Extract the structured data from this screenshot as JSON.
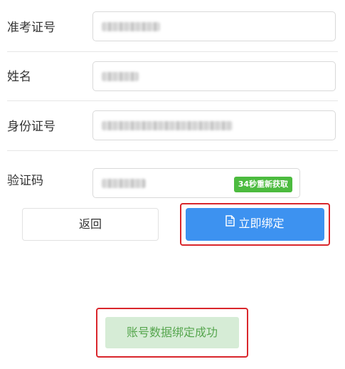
{
  "form": {
    "exam_id_label": "准考证号",
    "name_label": "姓名",
    "id_card_label": "身份证号",
    "code_label": "验证码",
    "refresh_label": "34秒重新获取"
  },
  "actions": {
    "back_label": "返回",
    "bind_label": "立即绑定",
    "bind_icon": "document-icon"
  },
  "status": {
    "success_text": "账号数据绑定成功"
  },
  "colors": {
    "primary": "#3d92f0",
    "green": "#4cbb3f",
    "highlight": "#d9262c",
    "success_bg": "#d6ecd6",
    "success_text": "#56a64e"
  }
}
